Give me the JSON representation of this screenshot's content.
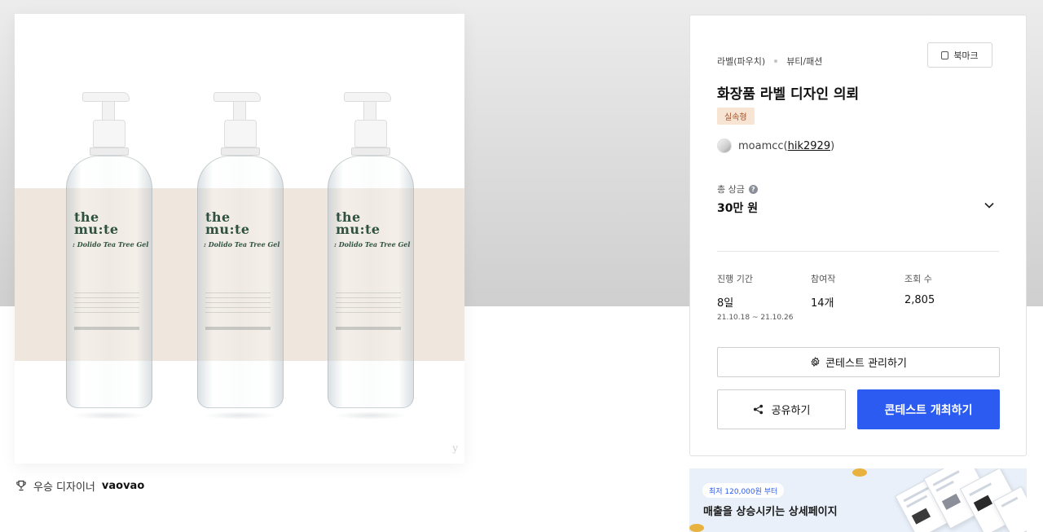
{
  "product_image": {
    "bottles": [
      {
        "brand": "the mu:te",
        "product": ": Dolido Tea Tree Gel"
      },
      {
        "brand": "the mu:te",
        "product": ": Dolido Tea Tree Gel"
      },
      {
        "brand": "the mu:te",
        "product": ": Dolido Tea Tree Gel"
      }
    ]
  },
  "winner": {
    "label": "우승 디자이너",
    "name": "vaovao",
    "icon": "trophy-icon"
  },
  "contest": {
    "category": "라벨(파우치)",
    "subcategory": "뷰티/패션",
    "bookmark_label": "북마크",
    "title": "화장품 라벨 디자인 의뢰",
    "badge": "실속형",
    "host_name": "moamcc",
    "host_handle": "hik2929",
    "prize_label": "총 상금",
    "prize_value": "30만 원",
    "stats": [
      {
        "label": "진행 기간",
        "value": "8일",
        "sub": "21.10.18 ~ 21.10.26"
      },
      {
        "label": "참여작",
        "value": "14개",
        "sub": ""
      },
      {
        "label": "조회 수",
        "value": "2,805",
        "sub": ""
      }
    ],
    "manage_label": "콘테스트 관리하기",
    "share_label": "공유하기",
    "open_label": "콘테스트 개최하기",
    "accent_color": "#2b5bf0",
    "badge_color": "#f7e4d3"
  },
  "ad": {
    "pill": "최저 120,000원 부터",
    "title": "매출을 상승시키는 상세페이지"
  }
}
